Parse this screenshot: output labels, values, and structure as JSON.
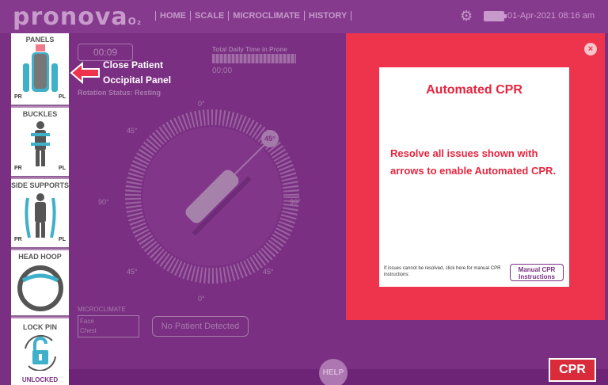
{
  "header": {
    "logo_text": "pronova",
    "logo_suffix": "O₂",
    "nav": [
      "HOME",
      "SCALE",
      "MICROCLIMATE",
      "HISTORY"
    ],
    "datetime": "01-Apr-2021 08:16 am"
  },
  "sidebar": {
    "panels_title": "PANELS",
    "buckles_title": "BUCKLES",
    "side_supports_title": "SIDE SUPPORTS",
    "head_hoop_title": "HEAD HOOP",
    "lock_pin_title": "LOCK PIN",
    "lock_state": "UNLOCKED",
    "pr_label": "PR",
    "pl_label": "PL"
  },
  "main": {
    "timer": "00:09",
    "daily_label": "Total Daily Time in Prone",
    "daily_value": "00:00",
    "rotation_status": "Rotation Status: Resting",
    "current_angle": "45°",
    "angles": [
      "0°",
      "45°",
      "45°",
      "90°",
      "90°",
      "45°",
      "45°",
      "0°"
    ],
    "microclimate_label": "MICROCLIMATE",
    "face_label": "Face",
    "chest_label": "Chest",
    "no_patient": "No Patient Detected",
    "help": "HELP"
  },
  "callout": {
    "line1": "Close Patient",
    "line2": "Occipital Panel"
  },
  "modal": {
    "title": "Automated CPR",
    "message": "Resolve all issues shown with arrows to enable Automated CPR.",
    "footer_text": "If issues cannot be resolved, click here for manual CPR instructions:",
    "manual_button": "Manual CPR Instructions",
    "close": "×"
  },
  "cpr_button": "CPR",
  "colors": {
    "modal_red": "#ee344d",
    "brand_purple": "#7a2f82",
    "sidebar_highlight": "#3fb0c9"
  }
}
